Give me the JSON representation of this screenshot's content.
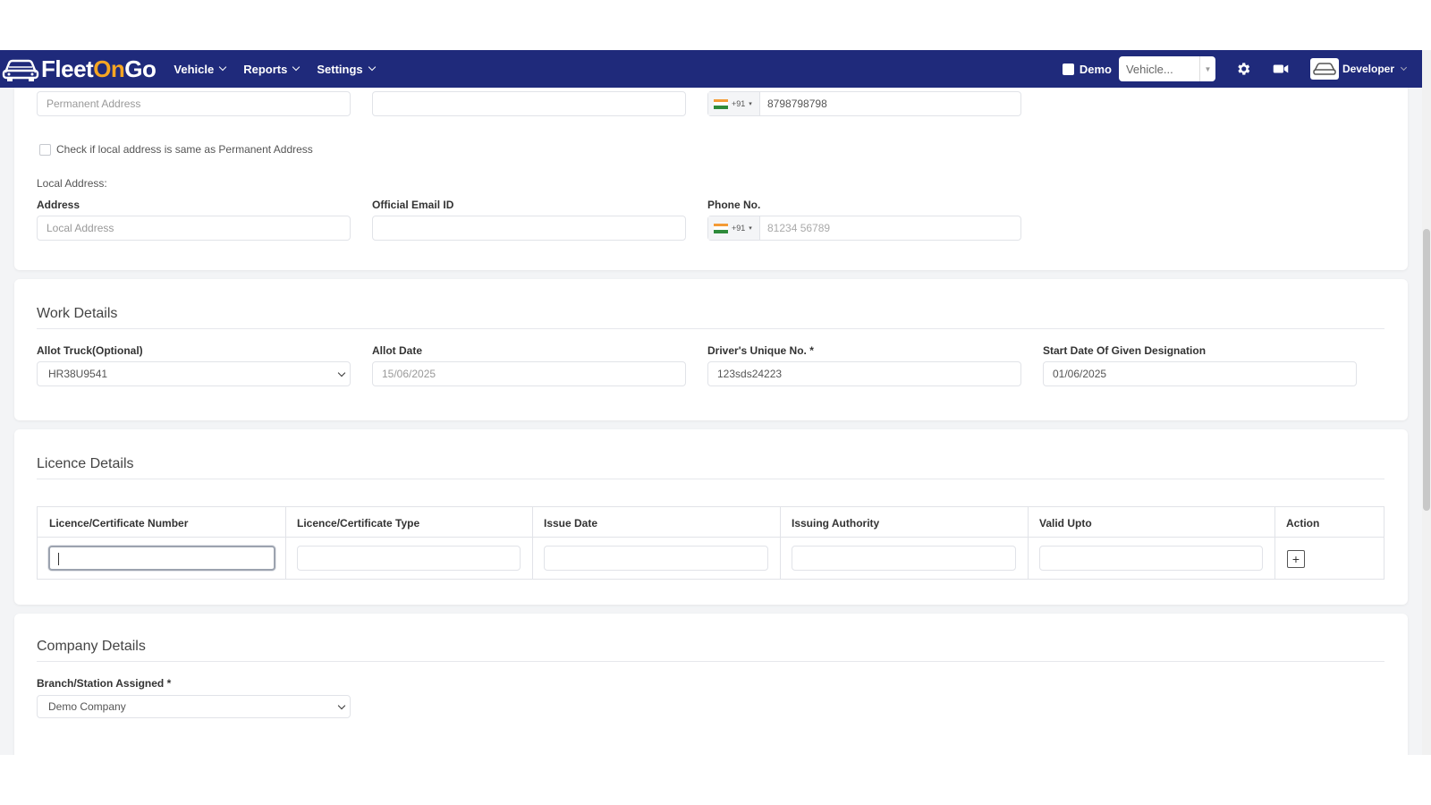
{
  "navbar": {
    "logo": {
      "fleet": "Fleet",
      "on": "On",
      "go": "Go"
    },
    "menu": [
      {
        "label": "Vehicle"
      },
      {
        "label": "Reports"
      },
      {
        "label": "Settings"
      }
    ],
    "demo_label": "Demo",
    "vehicle_select": "Vehicle...",
    "user_name": "Developer",
    "icons": [
      "car-logo-icon",
      "gear-icon",
      "video-camera-icon",
      "car-avatar-icon"
    ],
    "color": "#1f2a7b",
    "accent": "#f6a623"
  },
  "address": {
    "permanent_placeholder": "Permanent Address",
    "permanent_phone_code": "+91",
    "permanent_phone": "8798798798",
    "same_checkbox_label": "Check if local address is same as Permanent Address",
    "local_heading": "Local Address:",
    "address_label": "Address",
    "local_placeholder": "Local Address",
    "email_label": "Official Email ID",
    "phone_label": "Phone No.",
    "local_phone_code": "+91",
    "local_phone_placeholder": "81234 56789"
  },
  "work": {
    "title": "Work Details",
    "allot_truck_label": "Allot Truck(Optional)",
    "allot_truck_value": "HR38U9541",
    "allot_date_label": "Allot Date",
    "allot_date_value": "15/06/2025",
    "unique_no_label": "Driver's Unique No. *",
    "unique_no_value": "123sds24223",
    "start_date_label": "Start Date Of Given Designation",
    "start_date_value": "01/06/2025"
  },
  "licence": {
    "title": "Licence Details",
    "columns": [
      "Licence/Certificate Number",
      "Licence/Certificate Type",
      "Issue Date",
      "Issuing Authority",
      "Valid Upto",
      "Action"
    ],
    "add_button": "+"
  },
  "company": {
    "title": "Company Details",
    "branch_label": "Branch/Station Assigned *",
    "branch_value": "Demo Company"
  }
}
